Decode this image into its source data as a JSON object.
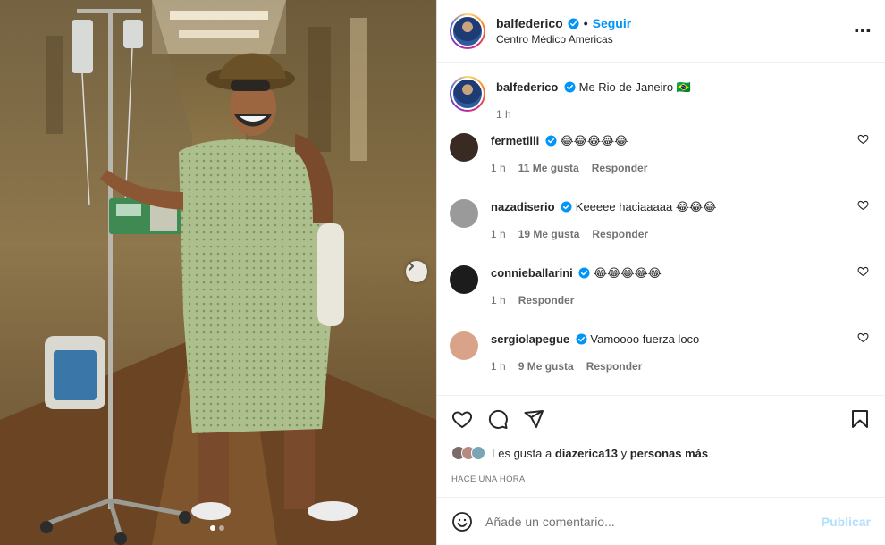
{
  "post": {
    "username": "balfederico",
    "location": "Centro Médico Americas",
    "follow_label": "Seguir",
    "separator": "•",
    "more_icon": "⋯"
  },
  "caption": {
    "username": "balfederico",
    "text": "Me Rio de Janeiro 🇧🇷",
    "time": "1 h"
  },
  "comments": [
    {
      "username": "fermetilli",
      "text": "😂😂😂😂😂",
      "time": "1 h",
      "likes": "11 Me gusta",
      "reply": "Responder",
      "avatar_color": "#3a2a24"
    },
    {
      "username": "nazadiserio",
      "text": "Keeeee haciaaaaa 😂😂😂",
      "time": "1 h",
      "likes": "19 Me gusta",
      "reply": "Responder",
      "avatar_color": "#9a9a9a"
    },
    {
      "username": "connieballarini",
      "text": "😂😂😂😂😂",
      "time": "1 h",
      "likes": "",
      "reply": "Responder",
      "avatar_color": "#1c1c1c"
    },
    {
      "username": "sergiolapegue",
      "text": "Vamoooo fuerza loco",
      "time": "1 h",
      "likes": "9 Me gusta",
      "reply": "Responder",
      "avatar_color": "#d9a38a"
    }
  ],
  "likes": {
    "prefix": "Les gusta a",
    "user": "diazerica13",
    "and": "y",
    "others": "personas más"
  },
  "timestamp": "Hace una hora",
  "add_comment": {
    "placeholder": "Añade un comentario...",
    "publish_label": "Publicar"
  },
  "colors": {
    "accent": "#0095f6",
    "verified": "#0095f6",
    "publish_disabled": "#b2dffc"
  }
}
